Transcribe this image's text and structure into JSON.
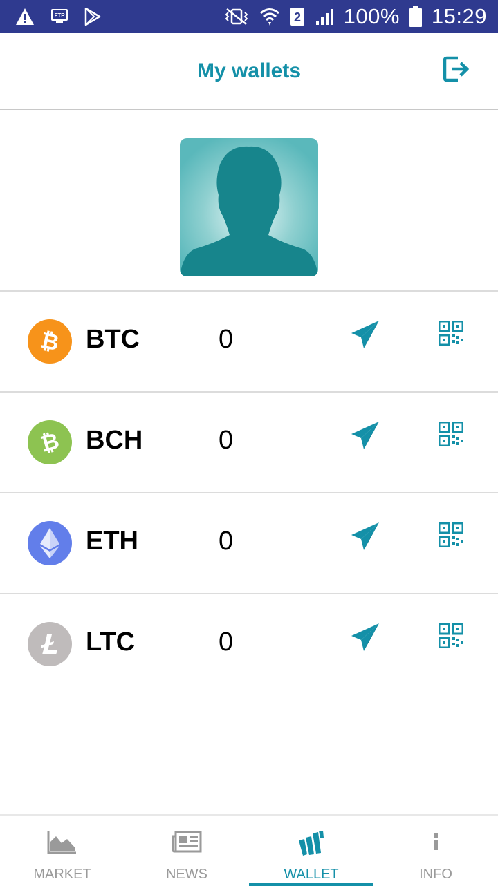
{
  "status_bar": {
    "left_icons": [
      "warning-icon",
      "ftp-icon",
      "play-store-icon"
    ],
    "right_icons": [
      "vibrate-mute-icon",
      "wifi-icon",
      "sim-2-icon",
      "signal-icon"
    ],
    "battery": "100%",
    "time": "15:29"
  },
  "header": {
    "title": "My wallets",
    "logout_icon": "logout-icon"
  },
  "profile": {
    "avatar_icon": "avatar-silhouette-icon"
  },
  "wallets": [
    {
      "symbol": "BTC",
      "balance": "0",
      "icon": "bitcoin-icon",
      "color": "#f7931a"
    },
    {
      "symbol": "BCH",
      "balance": "0",
      "icon": "bitcoin-cash-icon",
      "color": "#8dc351"
    },
    {
      "symbol": "ETH",
      "balance": "0",
      "icon": "ethereum-icon",
      "color": "#627eea"
    },
    {
      "symbol": "LTC",
      "balance": "0",
      "icon": "litecoin-icon",
      "color": "#bfbbbb"
    }
  ],
  "row_actions": {
    "send_icon": "paper-plane-icon",
    "receive_icon": "qr-code-icon"
  },
  "bottom_nav": [
    {
      "label": "MARKET",
      "icon": "area-chart-icon",
      "active": false
    },
    {
      "label": "NEWS",
      "icon": "newspaper-icon",
      "active": false
    },
    {
      "label": "WALLET",
      "icon": "wallet-logo-icon",
      "active": true
    },
    {
      "label": "INFO",
      "icon": "info-icon",
      "active": false
    }
  ],
  "colors": {
    "accent": "#1490a8",
    "status_bar": "#2f3a8f",
    "nav_inactive": "#9a9a9a"
  }
}
